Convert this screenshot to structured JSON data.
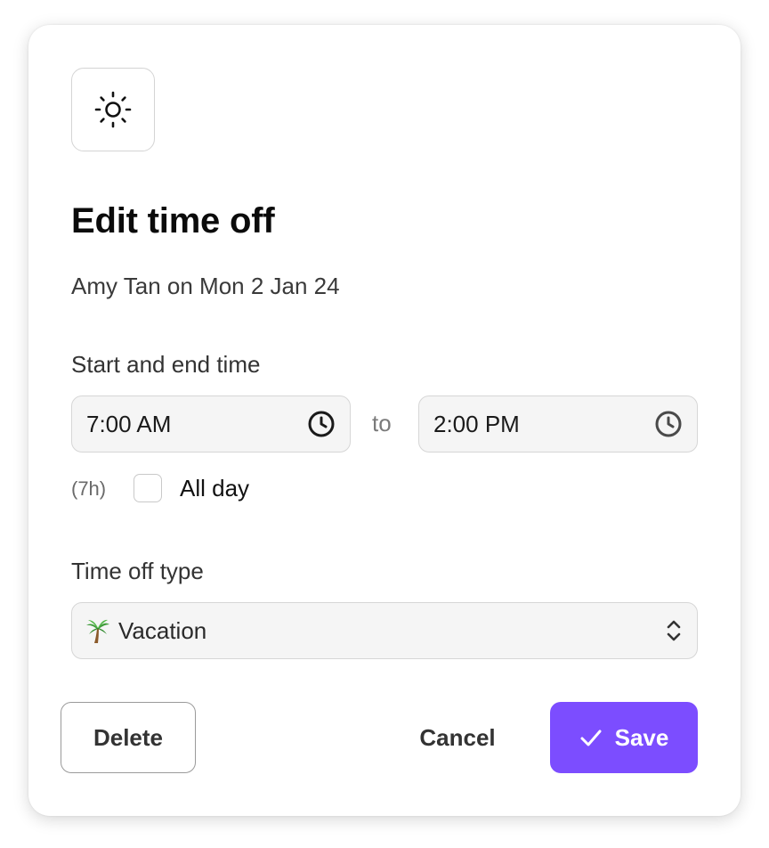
{
  "dialog": {
    "title": "Edit time off",
    "subtitle": "Amy Tan on Mon 2 Jan 24",
    "header_icon": "sun-icon"
  },
  "time": {
    "section_label": "Start and end time",
    "start_value": "7:00 AM",
    "end_value": "2:00 PM",
    "separator": "to",
    "field_icon": "clock-icon",
    "duration": "(7h)",
    "all_day_label": "All day",
    "all_day_checked": false
  },
  "time_off_type": {
    "label": "Time off type",
    "selected": "Vacation",
    "selected_icon": "palm-tree-icon",
    "dropdown_icon": "chevron-up-down-icon"
  },
  "actions": {
    "delete_label": "Delete",
    "cancel_label": "Cancel",
    "save_label": "Save",
    "save_icon": "check-icon"
  },
  "colors": {
    "accent": "#7c4dff",
    "field_bg": "#f5f5f5",
    "field_border": "#d6d6d6"
  }
}
